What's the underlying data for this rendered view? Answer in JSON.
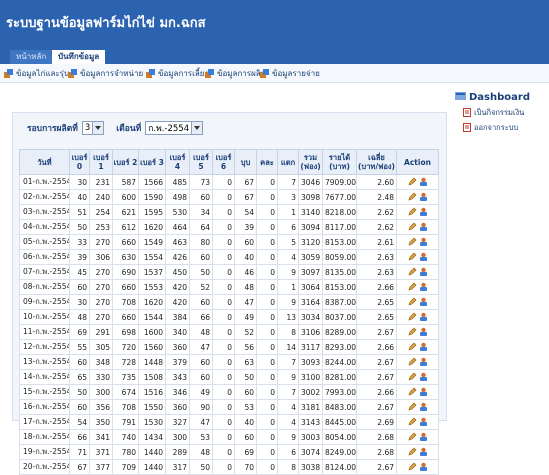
{
  "app": {
    "title": "ระบบฐานข้อมูลฟาร์มไก่ไข่ มก.ฉกส"
  },
  "tabs": [
    {
      "label": "หน้าหลัก"
    },
    {
      "label": "บันทึกข้อมูล"
    }
  ],
  "toolbar": {
    "items": [
      {
        "label": "ข้อมูลไก่และรุ่น",
        "icon": "data-icon"
      },
      {
        "label": "ข้อมูลการจำหน่าย",
        "icon": "data-icon"
      },
      {
        "label": "ข้อมูลการเลี้ยง",
        "icon": "data-icon"
      },
      {
        "label": "ข้อมูลการผลิต",
        "icon": "data-icon"
      },
      {
        "label": "ข้อมูลรายจ่าย",
        "icon": "data-icon"
      }
    ]
  },
  "filter": {
    "batch_label": "รอบการผลิตที่",
    "batch_value": "3",
    "month_label": "เดือนที่",
    "month_value": "ก.พ.-2554"
  },
  "table": {
    "headers": [
      "วันที่",
      "เบอร์ 0",
      "เบอร์ 1",
      "เบอร์ 2",
      "เบอร์ 3",
      "เบอร์ 4",
      "เบอร์ 5",
      "เบอร์ 6",
      "บุบ",
      "คละ",
      "แตก",
      "รวม (ฟอง)",
      "รายได้ (บาท)",
      "เฉลี่ย (บาท/ฟอง)",
      "Action"
    ],
    "rows": [
      [
        "01-ก.พ.-2554",
        "30",
        "231",
        "587",
        "1566",
        "485",
        "73",
        "0",
        "67",
        "0",
        "7",
        "3046",
        "7909.00",
        "2.60"
      ],
      [
        "02-ก.พ.-2554",
        "40",
        "240",
        "600",
        "1590",
        "498",
        "60",
        "0",
        "67",
        "0",
        "3",
        "3098",
        "7677.00",
        "2.48"
      ],
      [
        "03-ก.พ.-2554",
        "51",
        "254",
        "621",
        "1595",
        "530",
        "34",
        "0",
        "54",
        "0",
        "1",
        "3140",
        "8218.00",
        "2.62"
      ],
      [
        "04-ก.พ.-2554",
        "50",
        "253",
        "612",
        "1620",
        "464",
        "64",
        "0",
        "39",
        "0",
        "6",
        "3094",
        "8117.00",
        "2.62"
      ],
      [
        "05-ก.พ.-2554",
        "33",
        "270",
        "660",
        "1549",
        "463",
        "80",
        "0",
        "60",
        "0",
        "5",
        "3120",
        "8153.00",
        "2.61"
      ],
      [
        "06-ก.พ.-2554",
        "39",
        "306",
        "630",
        "1554",
        "426",
        "60",
        "0",
        "40",
        "0",
        "4",
        "3059",
        "8059.00",
        "2.63"
      ],
      [
        "07-ก.พ.-2554",
        "45",
        "270",
        "690",
        "1537",
        "450",
        "50",
        "0",
        "46",
        "0",
        "9",
        "3097",
        "8135.00",
        "2.63"
      ],
      [
        "08-ก.พ.-2554",
        "60",
        "270",
        "660",
        "1553",
        "420",
        "52",
        "0",
        "48",
        "0",
        "1",
        "3064",
        "8153.00",
        "2.66"
      ],
      [
        "09-ก.พ.-2554",
        "30",
        "270",
        "708",
        "1620",
        "420",
        "60",
        "0",
        "47",
        "0",
        "9",
        "3164",
        "8387.00",
        "2.65"
      ],
      [
        "10-ก.พ.-2554",
        "48",
        "270",
        "660",
        "1544",
        "384",
        "66",
        "0",
        "49",
        "0",
        "13",
        "3034",
        "8037.00",
        "2.65"
      ],
      [
        "11-ก.พ.-2554",
        "69",
        "291",
        "698",
        "1600",
        "340",
        "48",
        "0",
        "52",
        "0",
        "8",
        "3106",
        "8289.00",
        "2.67"
      ],
      [
        "12-ก.พ.-2554",
        "55",
        "305",
        "720",
        "1560",
        "360",
        "47",
        "0",
        "56",
        "0",
        "14",
        "3117",
        "8293.00",
        "2.66"
      ],
      [
        "13-ก.พ.-2554",
        "60",
        "348",
        "728",
        "1448",
        "379",
        "60",
        "0",
        "63",
        "0",
        "7",
        "3093",
        "8244.00",
        "2.67"
      ],
      [
        "14-ก.พ.-2554",
        "65",
        "330",
        "735",
        "1508",
        "343",
        "60",
        "0",
        "50",
        "0",
        "9",
        "3100",
        "8281.00",
        "2.67"
      ],
      [
        "15-ก.พ.-2554",
        "50",
        "300",
        "674",
        "1516",
        "346",
        "49",
        "0",
        "60",
        "0",
        "7",
        "3002",
        "7993.00",
        "2.66"
      ],
      [
        "16-ก.พ.-2554",
        "60",
        "356",
        "708",
        "1550",
        "360",
        "90",
        "0",
        "53",
        "0",
        "4",
        "3181",
        "8483.00",
        "2.67"
      ],
      [
        "17-ก.พ.-2554",
        "54",
        "350",
        "791",
        "1530",
        "327",
        "47",
        "0",
        "40",
        "0",
        "4",
        "3143",
        "8445.00",
        "2.69"
      ],
      [
        "18-ก.พ.-2554",
        "66",
        "341",
        "740",
        "1434",
        "300",
        "53",
        "0",
        "60",
        "0",
        "9",
        "3003",
        "8054.00",
        "2.68"
      ],
      [
        "19-ก.พ.-2554",
        "71",
        "371",
        "780",
        "1440",
        "289",
        "48",
        "0",
        "69",
        "0",
        "6",
        "3074",
        "8249.00",
        "2.68"
      ],
      [
        "20-ก.พ.-2554",
        "67",
        "377",
        "709",
        "1440",
        "317",
        "50",
        "0",
        "70",
        "0",
        "8",
        "3038",
        "8124.00",
        "2.67"
      ]
    ]
  },
  "sidebar": {
    "title": "Dashboard",
    "links": [
      {
        "label": "เป็นกิจกรรมเงิน",
        "icon": "document-icon"
      },
      {
        "label": "ออกจากระบบ",
        "icon": "document-icon"
      }
    ]
  },
  "colors": {
    "header_bg": "#2b63b0",
    "panel_bg": "#f2f6fb",
    "accent_text": "#1a3f78"
  }
}
